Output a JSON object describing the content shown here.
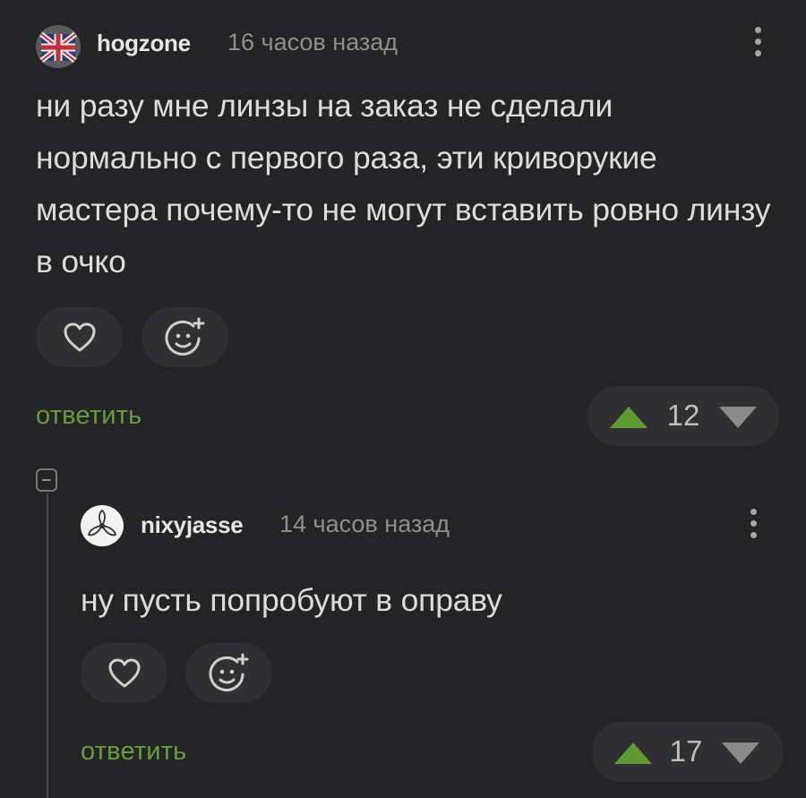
{
  "comments": [
    {
      "username": "hogzone",
      "time": "16 часов назад",
      "text": "ни разу мне линзы на заказ не сделали нормально с первого раза, эти криворукие мастера почему-то не могут вставить ровно линзу в очко",
      "reply_label": "ответить",
      "rating": "12"
    },
    {
      "username": "nixyjasse",
      "time": "14 часов назад",
      "text": "ну пусть попробуют в оправу",
      "reply_label": "ответить",
      "rating": "17"
    }
  ],
  "colors": {
    "background": "#242426",
    "pill": "#303032",
    "accent_green": "#6a9a3e",
    "upvote": "#5f9a32",
    "downvote": "#8a8a8a"
  },
  "icons": [
    "uk-flag-avatar",
    "propeller-avatar",
    "kebab-menu-icon",
    "heart-icon",
    "emoji-add-icon",
    "upvote-arrow-icon",
    "downvote-arrow-icon",
    "collapse-icon"
  ]
}
